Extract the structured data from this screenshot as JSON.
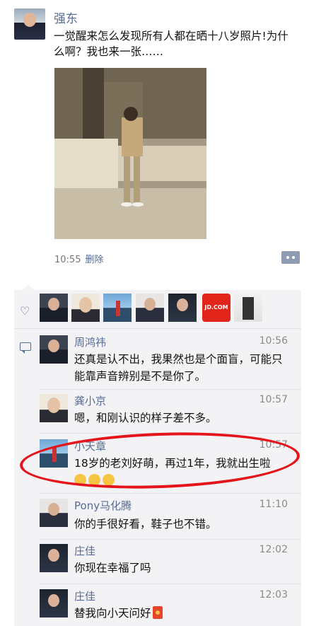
{
  "post": {
    "author": "强东",
    "text": "一觉醒来怎么发现所有人都在晒十八岁照片!为什么啊？我也来一张……",
    "time": "10:55",
    "delete_label": "删除"
  },
  "likes": {
    "icon": "heart-outline-icon",
    "jd_text": "JD.COM"
  },
  "comments": [
    {
      "name": "周鸿祎",
      "time": "10:56",
      "text": "还真是认不出，我果然也是个面盲，可能只能靠声音辨别是不是你了。"
    },
    {
      "name": "龚小京",
      "time": "10:57",
      "text": "嗯，和刚认识的样子差不多。"
    },
    {
      "name": "小天章",
      "time": "10:57",
      "text": "18岁的老刘好萌，再过1年，我就出生啦"
    },
    {
      "name": "Pony马化腾",
      "time": "11:10",
      "text": "你的手很好看，鞋子也不错。"
    },
    {
      "name": "庄佳",
      "time": "12:02",
      "text": "你现在幸福了吗"
    },
    {
      "name": "庄佳",
      "time": "12:03",
      "text": "替我向小天问好"
    }
  ],
  "colors": {
    "link": "#576b95",
    "highlight": "#e5141b",
    "panel": "#f3f3f5"
  }
}
